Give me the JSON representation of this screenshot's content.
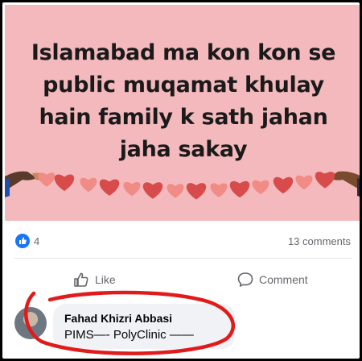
{
  "post": {
    "image_text": "Islamabad ma kon kon se\npublic muqamat khulay\nhain family k sath jahan\njaha sakay",
    "background_color": "#f4b9bd",
    "heart_colors": [
      "#f08b86",
      "#d84b4b"
    ]
  },
  "stats": {
    "reaction_icon": "like-reaction-icon",
    "reaction_count": "4",
    "comments_label": "13 comments"
  },
  "actions": {
    "like_label": "Like",
    "comment_label": "Comment"
  },
  "comment": {
    "author": "Fahad Khizri Abbasi",
    "text": "PIMS—- PolyClinic ——"
  },
  "annotation": {
    "color": "#e11b1b"
  }
}
